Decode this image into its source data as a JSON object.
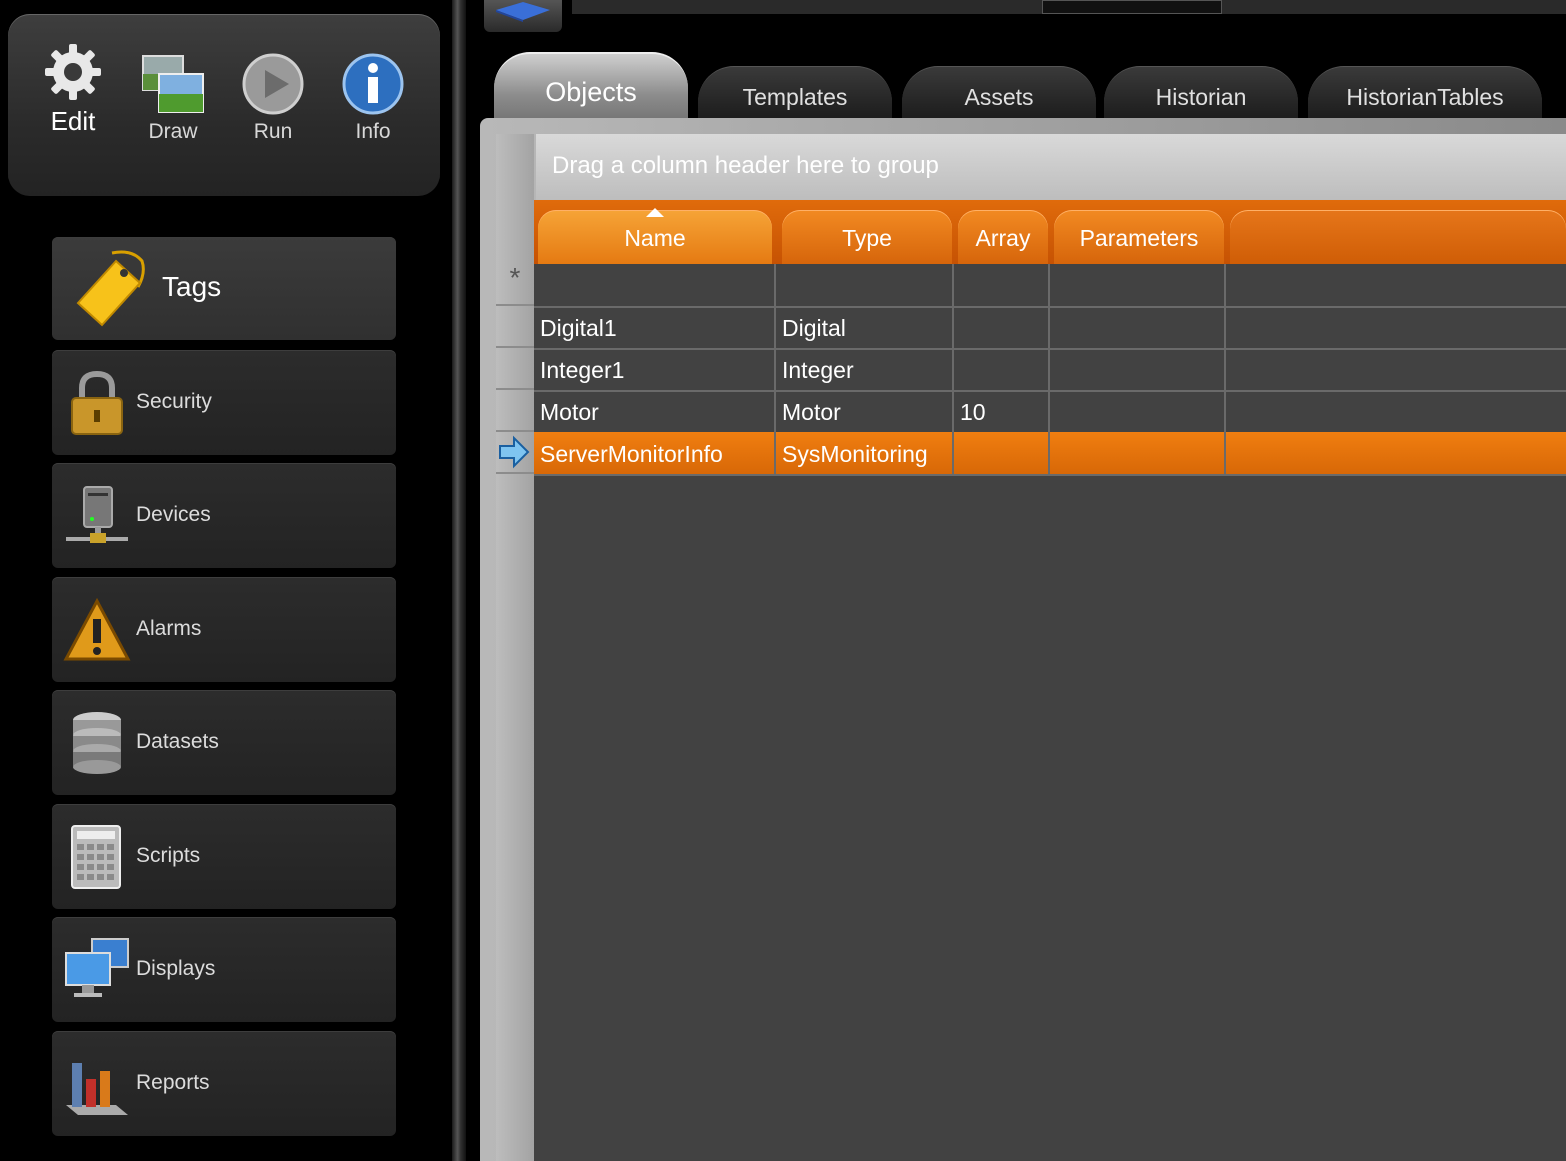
{
  "modes": [
    {
      "label": "Edit",
      "icon": "gear-icon",
      "active": true
    },
    {
      "label": "Draw",
      "icon": "pictures-icon",
      "active": false
    },
    {
      "label": "Run",
      "icon": "play-icon",
      "active": false
    },
    {
      "label": "Info",
      "icon": "info-icon",
      "active": false
    }
  ],
  "nav": [
    {
      "label": "Tags",
      "icon": "tag-icon",
      "active": true
    },
    {
      "label": "Security",
      "icon": "lock-icon"
    },
    {
      "label": "Devices",
      "icon": "server-icon"
    },
    {
      "label": "Alarms",
      "icon": "warning-icon"
    },
    {
      "label": "Datasets",
      "icon": "database-icon"
    },
    {
      "label": "Scripts",
      "icon": "calculator-icon"
    },
    {
      "label": "Displays",
      "icon": "monitors-icon"
    },
    {
      "label": "Reports",
      "icon": "bar-chart-icon"
    }
  ],
  "tabs": [
    "Objects",
    "Templates",
    "Assets",
    "Historian",
    "HistorianTables"
  ],
  "active_tab": "Objects",
  "grid": {
    "group_hint": "Drag a column header here to group",
    "columns": [
      "Name",
      "Type",
      "Array",
      "Parameters"
    ],
    "sorted_column": "Name",
    "new_row_marker": "*",
    "rows": [
      {
        "name": "Digital1",
        "type": "Digital",
        "array": "",
        "parameters": ""
      },
      {
        "name": "Integer1",
        "type": "Integer",
        "array": "",
        "parameters": ""
      },
      {
        "name": "Motor",
        "type": "Motor",
        "array": "10",
        "parameters": ""
      },
      {
        "name": "ServerMonitorInfo",
        "type": "SysMonitoring",
        "array": "",
        "parameters": "",
        "selected": true
      }
    ]
  },
  "colors": {
    "accent": "#e06b0b",
    "selected_row": "#e8760c",
    "background": "#000000",
    "grid_body": "#424242"
  }
}
